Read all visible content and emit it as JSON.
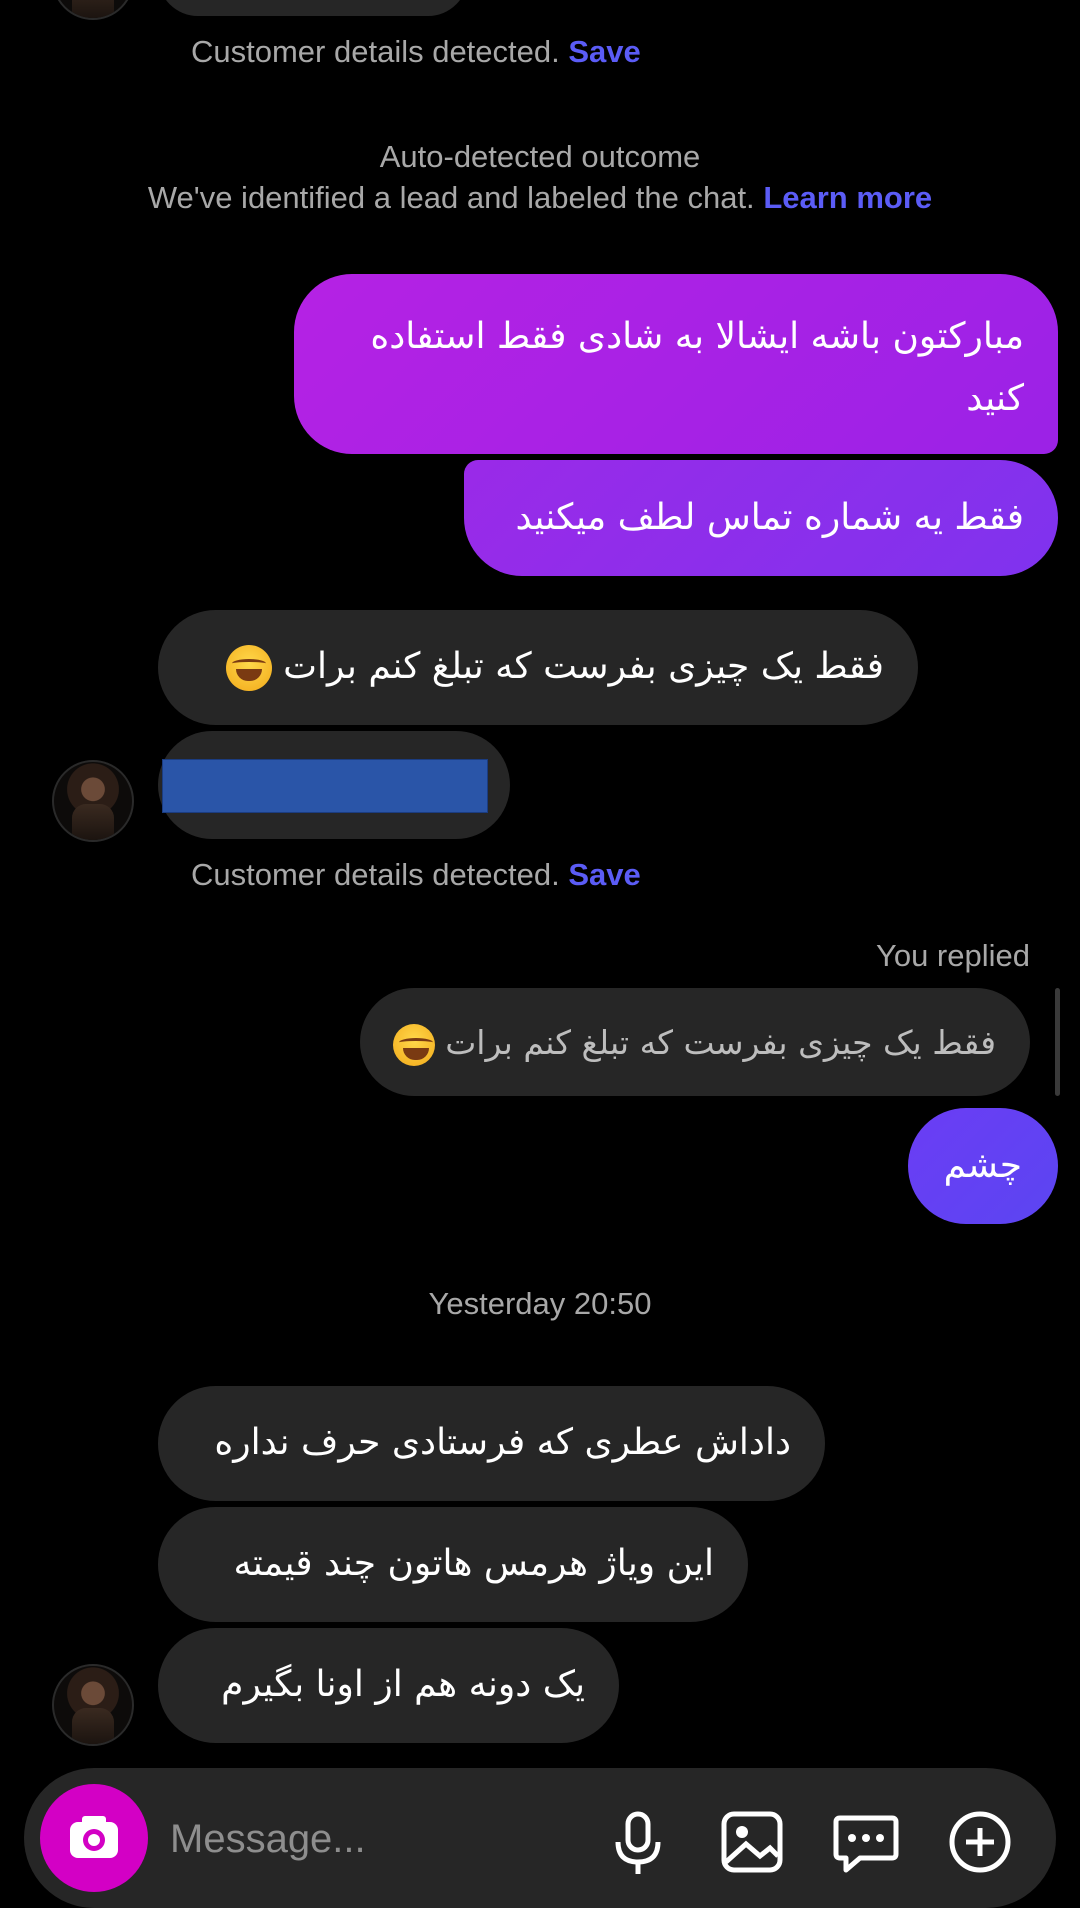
{
  "detected_1": {
    "text": "Customer details detected.",
    "save": "Save"
  },
  "outcome": {
    "title": "Auto-detected outcome",
    "body": "We've identified a lead and labeled the chat.",
    "link": "Learn more"
  },
  "messages": {
    "out_1": "مبارکتون باشه ایشالا به شادی فقط استفاده کنید",
    "out_2": "فقط یه شماره تماس لطف میکنید",
    "in_1": "فقط یک چیزی بفرست که تبلغ کنم برات",
    "detected_2": {
      "text": "Customer details detected.",
      "save": "Save"
    },
    "reply_label": "You replied",
    "reply_quote": "فقط یک چیزی بفرست که تبلغ کنم برات",
    "out_3": "چشم",
    "timestamp": "Yesterday 20:50",
    "in_2": "داداش عطری که فرستادی حرف نداره",
    "in_3": "این ویاژ هرمس هاتون چند قیمته",
    "in_4": "یک دونه هم از اونا بگیرم"
  },
  "composer": {
    "placeholder": "Message..."
  },
  "colors": {
    "accent_link": "#5b5cf6",
    "bubble_out_top": "#a21fe0",
    "bubble_out_bottom": "#6a3cf4",
    "bubble_in": "#262626",
    "camera_button": "#d300c5",
    "redaction": "#2a55a8"
  },
  "icons": [
    "camera-icon",
    "microphone-icon",
    "gallery-icon",
    "sticker-chat-icon",
    "plus-icon"
  ]
}
